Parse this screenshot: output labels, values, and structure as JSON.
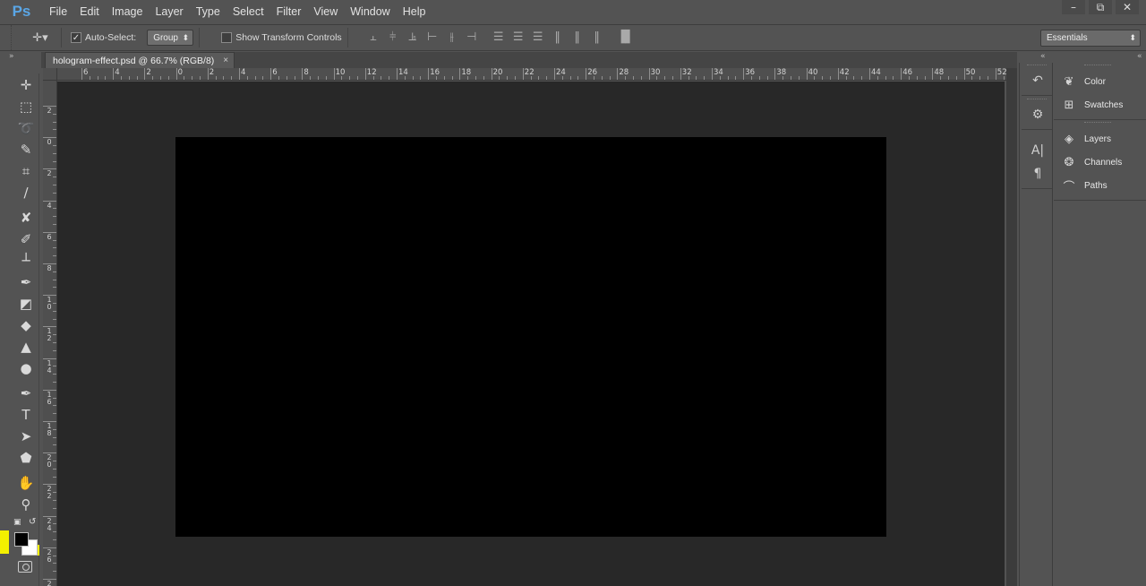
{
  "app": {
    "logo": "Ps"
  },
  "menu": [
    "File",
    "Edit",
    "Image",
    "Layer",
    "Type",
    "Select",
    "Filter",
    "View",
    "Window",
    "Help"
  ],
  "window_controls": {
    "minimize": "–",
    "restore": "⧉",
    "close": "✕"
  },
  "options_bar": {
    "tool_icon": "move-tool-icon",
    "auto_select_label": "Auto-Select:",
    "auto_select_checked": true,
    "group_value": "Group",
    "show_transform_label": "Show Transform Controls",
    "show_transform_checked": false,
    "workspace": "Essentials"
  },
  "document": {
    "tab_title": "hologram-effect.psd @ 66.7% (RGB/8)",
    "close": "×"
  },
  "rulers": {
    "top_labels": [
      "6",
      "4",
      "2",
      "0",
      "2",
      "4",
      "6",
      "8",
      "10",
      "12",
      "14",
      "16",
      "18",
      "20",
      "22",
      "24",
      "26",
      "28",
      "30",
      "32",
      "34",
      "36",
      "38",
      "40",
      "42",
      "44",
      "46",
      "48",
      "50",
      "52"
    ],
    "left_labels": [
      "2",
      "0",
      "2",
      "4",
      "6",
      "8",
      "10",
      "12",
      "14",
      "16",
      "18",
      "20",
      "22",
      "24",
      "26",
      "2"
    ]
  },
  "colors": {
    "foreground": "#000000",
    "background": "#ffffff",
    "highlight": "#f4f000",
    "canvas": "#000000",
    "pasteboard": "#282828",
    "chrome": "#535353"
  },
  "tools": [
    "move-tool-icon",
    "marquee-tool-icon",
    "lasso-tool-icon",
    "quick-selection-tool-icon",
    "crop-tool-icon",
    "eyedropper-tool-icon",
    "healing-brush-tool-icon",
    "brush-tool-icon",
    "clone-stamp-tool-icon",
    "history-brush-tool-icon",
    "eraser-tool-icon",
    "paint-bucket-tool-icon",
    "blur-tool-icon",
    "dodge-tool-icon",
    "pen-tool-icon",
    "type-tool-icon",
    "path-selection-tool-icon",
    "shape-tool-icon",
    "hand-tool-icon",
    "zoom-tool-icon"
  ],
  "panels": [
    {
      "label": "Color",
      "icon": "color-panel-icon"
    },
    {
      "label": "Swatches",
      "icon": "swatches-panel-icon"
    },
    {
      "label": "Layers",
      "icon": "layers-panel-icon"
    },
    {
      "label": "Channels",
      "icon": "channels-panel-icon"
    },
    {
      "label": "Paths",
      "icon": "paths-panel-icon"
    }
  ]
}
